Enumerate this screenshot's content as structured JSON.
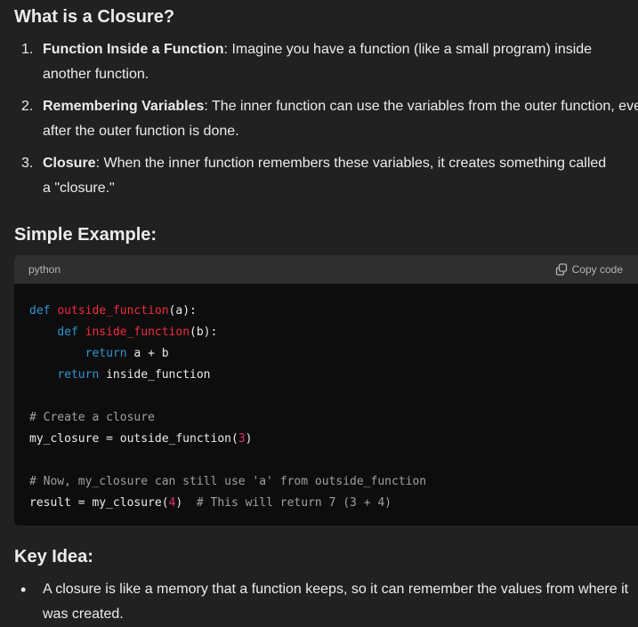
{
  "headings": {
    "closure": "What is a Closure?",
    "example": "Simple Example:",
    "key_idea": "Key Idea:"
  },
  "steps": [
    {
      "num": "1.",
      "title": "Function Inside a Function",
      "text": ": Imagine you have a function (like a small program) inside another function."
    },
    {
      "num": "2.",
      "title": "Remembering Variables",
      "text": ": The inner function can use the variables from the outer function, even after the outer function is done."
    },
    {
      "num": "3.",
      "title": "Closure",
      "text": ": When the inner function remembers these variables, it creates something called a \"closure.\""
    }
  ],
  "code_block": {
    "language": "python",
    "copy_label": "Copy code",
    "lines": [
      "def outside_function(a):",
      "    def inside_function(b):",
      "        return a + b",
      "    return inside_function",
      "",
      "# Create a closure",
      "my_closure = outside_function(3)",
      "",
      "# Now, my_closure can still use 'a' from outside_function",
      "result = my_closure(4)  # This will return 7 (3 + 4)"
    ]
  },
  "key_idea": {
    "items": [
      "A closure is like a memory that a function keeps, so it can remember the values from where it was created."
    ]
  },
  "icons": {
    "copy": "copy-icon"
  },
  "colors": {
    "background": "#212121",
    "code_background": "#0d0d0d",
    "code_header": "#2f2f2f",
    "keyword": "#2e95d3",
    "function_name": "#f22c3d",
    "number": "#df3079",
    "comment": "#a0a0a0"
  }
}
